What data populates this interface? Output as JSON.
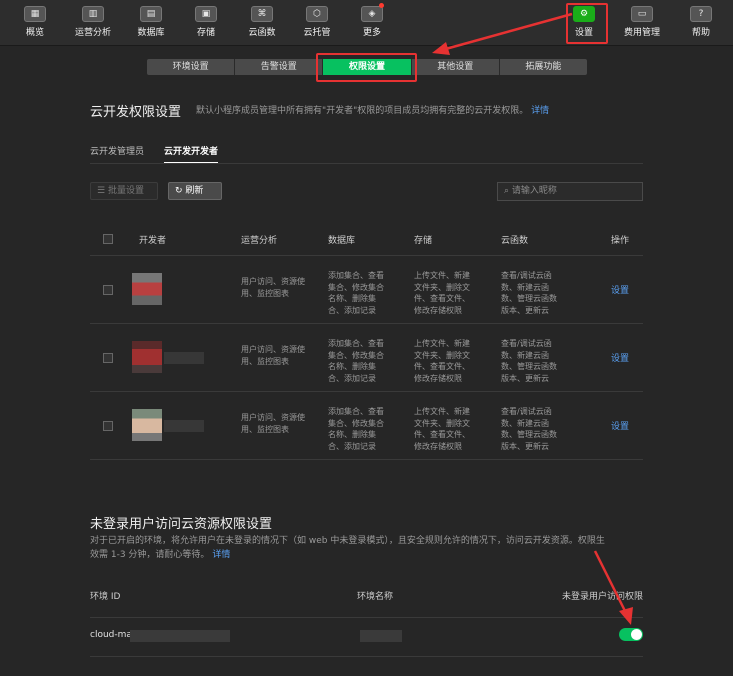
{
  "toolbar": {
    "items": [
      {
        "label": "概览",
        "icon": "overview-icon",
        "glyph": "▦"
      },
      {
        "label": "运营分析",
        "icon": "analytics-icon",
        "glyph": "▥"
      },
      {
        "label": "数据库",
        "icon": "database-icon",
        "glyph": "▤"
      },
      {
        "label": "存储",
        "icon": "storage-icon",
        "glyph": "▣"
      },
      {
        "label": "云函数",
        "icon": "function-icon",
        "glyph": "⌘"
      },
      {
        "label": "云托管",
        "icon": "hosting-icon",
        "glyph": "⬡"
      },
      {
        "label": "更多",
        "icon": "more-icon",
        "glyph": "◈"
      },
      {
        "label": "设置",
        "icon": "gear-icon",
        "glyph": "⚙"
      },
      {
        "label": "费用管理",
        "icon": "billing-icon",
        "glyph": "▭"
      },
      {
        "label": "帮助",
        "icon": "help-icon",
        "glyph": "?"
      }
    ]
  },
  "subtabs": [
    "环境设置",
    "告警设置",
    "权限设置",
    "其他设置",
    "拓展功能"
  ],
  "permissions": {
    "title": "云开发权限设置",
    "desc": "默认小程序成员管理中所有拥有\"开发者\"权限的项目成员均拥有完整的云开发权限。",
    "desc_link": "详情",
    "role_tabs": [
      "云开发管理员",
      "云开发开发者"
    ],
    "batch_label": "批量设置",
    "refresh_label": "刷新",
    "search_placeholder": "请输入昵称",
    "headers": [
      "开发者",
      "运营分析",
      "数据库",
      "存储",
      "云函数",
      "操作"
    ],
    "rows": [
      {
        "analytics": "用户访问、资源使用、监控图表",
        "database": "添加集合、查看集合、修改集合名称、删除集合、添加记录",
        "storage": "上传文件、新建文件夹、删除文件、查看文件、修改存储权限",
        "functions": "查看/调试云函数、新建云函数、管理云函数版本、更新云",
        "action": "设置"
      },
      {
        "analytics": "用户访问、资源使用、监控图表",
        "database": "添加集合、查看集合、修改集合名称、删除集合、添加记录",
        "storage": "上传文件、新建文件夹、删除文件、查看文件、修改存储权限",
        "functions": "查看/调试云函数、新建云函数、管理云函数版本、更新云",
        "action": "设置"
      },
      {
        "analytics": "用户访问、资源使用、监控图表",
        "database": "添加集合、查看集合、修改集合名称、删除集合、添加记录",
        "storage": "上传文件、新建文件夹、删除文件、查看文件、修改存储权限",
        "functions": "查看/调试云函数、新建云函数、管理云函数版本、更新云",
        "action": "设置"
      }
    ]
  },
  "guest": {
    "title": "未登录用户访问云资源权限设置",
    "desc_line1": "对于已开启的环境，将允许用户在未登录的情况下（如 web 中未登录模式），且安全规则允许的情况下，访问云开发资源。权限生",
    "desc_line2": "效需 1-3 分钟，请耐心等待。",
    "desc_link": "详情",
    "headers": [
      "环境 ID",
      "环境名称",
      "未登录用户访问权限"
    ],
    "env_id": "cloud-ma",
    "toggle_on": true
  },
  "colors": {
    "accent": "#07c160",
    "link": "#5aa0f2",
    "highlight": "#e63232"
  }
}
